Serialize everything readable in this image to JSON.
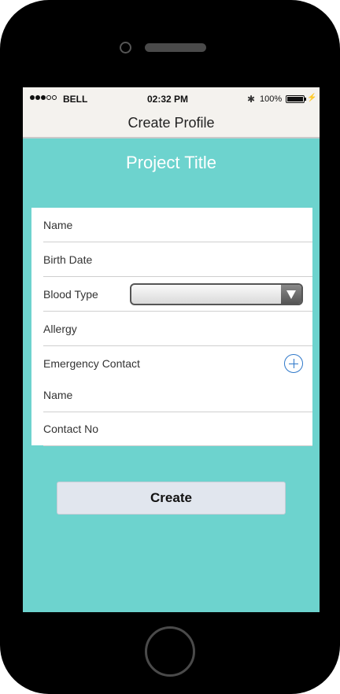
{
  "status_bar": {
    "carrier": "BELL",
    "time": "02:32 PM",
    "battery": "100%",
    "bluetooth_icon": "bluetooth-icon",
    "signal_bars_filled": 3,
    "signal_bars_total": 5
  },
  "nav": {
    "title": "Create Profile"
  },
  "header": {
    "project_title": "Project Title"
  },
  "form": {
    "name_label": "Name",
    "birth_date_label": "Birth Date",
    "blood_type_label": "Blood Type",
    "blood_type_value": "",
    "allergy_label": "Allergy",
    "emergency_contact_label": "Emergency Contact",
    "emergency_name_label": "Name",
    "contact_no_label": "Contact No"
  },
  "actions": {
    "create_label": "Create"
  },
  "colors": {
    "background": "#6dd3ce",
    "bar": "#f4f2ee",
    "button": "#e1e6ee",
    "accent": "#2d77c9"
  }
}
